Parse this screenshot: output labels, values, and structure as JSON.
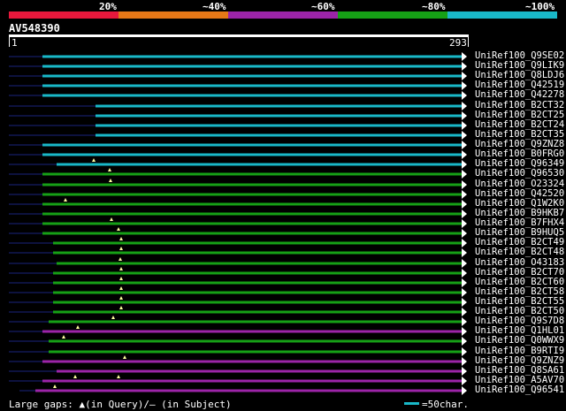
{
  "colors": {
    "red": "#e8183c",
    "orange": "#e67817",
    "purple": "#9c24a8",
    "green": "#16a016",
    "cyan": "#19b8c8",
    "navy": "#1a237e",
    "white": "#ffffff",
    "gap_marker": "#fffea0"
  },
  "legend": {
    "labels": [
      "20%",
      "~40%",
      "~60%",
      "~80%",
      "~100%"
    ],
    "colors": [
      "red",
      "orange",
      "purple",
      "green",
      "cyan"
    ]
  },
  "query": {
    "id": "AV548390",
    "start": "1",
    "end": "293"
  },
  "hits": [
    {
      "label": "UniRef100_Q9SE02",
      "color": "cyan"
    },
    {
      "label": "UniRef100_Q9LIK9",
      "color": "cyan"
    },
    {
      "label": "UniRef100_Q8LDJ6",
      "color": "cyan"
    },
    {
      "label": "UniRef100_Q42519",
      "color": "cyan"
    },
    {
      "label": "UniRef100_Q42278",
      "color": "cyan"
    },
    {
      "label": "UniRef100_B2CT32",
      "color": "cyan"
    },
    {
      "label": "UniRef100_B2CT25",
      "color": "cyan"
    },
    {
      "label": "UniRef100_B2CT24",
      "color": "cyan"
    },
    {
      "label": "UniRef100_B2CT35",
      "color": "cyan"
    },
    {
      "label": "UniRef100_Q9ZNZ8",
      "color": "cyan"
    },
    {
      "label": "UniRef100_B0FRG0",
      "color": "cyan"
    },
    {
      "label": "UniRef100_Q96349",
      "color": "cyan"
    },
    {
      "label": "UniRef100_Q96530",
      "color": "green"
    },
    {
      "label": "UniRef100_O23324",
      "color": "green"
    },
    {
      "label": "UniRef100_Q42520",
      "color": "green"
    },
    {
      "label": "UniRef100_Q1W2K0",
      "color": "green"
    },
    {
      "label": "UniRef100_B9HKB7",
      "color": "green"
    },
    {
      "label": "UniRef100_B7FHX4",
      "color": "green"
    },
    {
      "label": "UniRef100_B9HUQ5",
      "color": "green"
    },
    {
      "label": "UniRef100_B2CT49",
      "color": "green"
    },
    {
      "label": "UniRef100_B2CT48",
      "color": "green"
    },
    {
      "label": "UniRef100_O43183",
      "color": "green"
    },
    {
      "label": "UniRef100_B2CT70",
      "color": "green"
    },
    {
      "label": "UniRef100_B2CT60",
      "color": "green"
    },
    {
      "label": "UniRef100_B2CT58",
      "color": "green"
    },
    {
      "label": "UniRef100_B2CT55",
      "color": "green"
    },
    {
      "label": "UniRef100_B2CT50",
      "color": "green"
    },
    {
      "label": "UniRef100_Q9S7D8",
      "color": "green"
    },
    {
      "label": "UniRef100_Q1HL01",
      "color": "purple"
    },
    {
      "label": "UniRef100_Q0WWX9",
      "color": "green"
    },
    {
      "label": "UniRef100_B9RTI9",
      "color": "green"
    },
    {
      "label": "UniRef100_Q9ZNZ9",
      "color": "purple"
    },
    {
      "label": "UniRef100_Q8SA61",
      "color": "purple"
    },
    {
      "label": "UniRef100_A5AV70",
      "color": "purple"
    },
    {
      "label": "UniRef100_Q96541",
      "color": "purple"
    }
  ],
  "footer": {
    "text": "Large gaps: ▲(in Query)/– (in Subject)",
    "scale": "=50char."
  }
}
